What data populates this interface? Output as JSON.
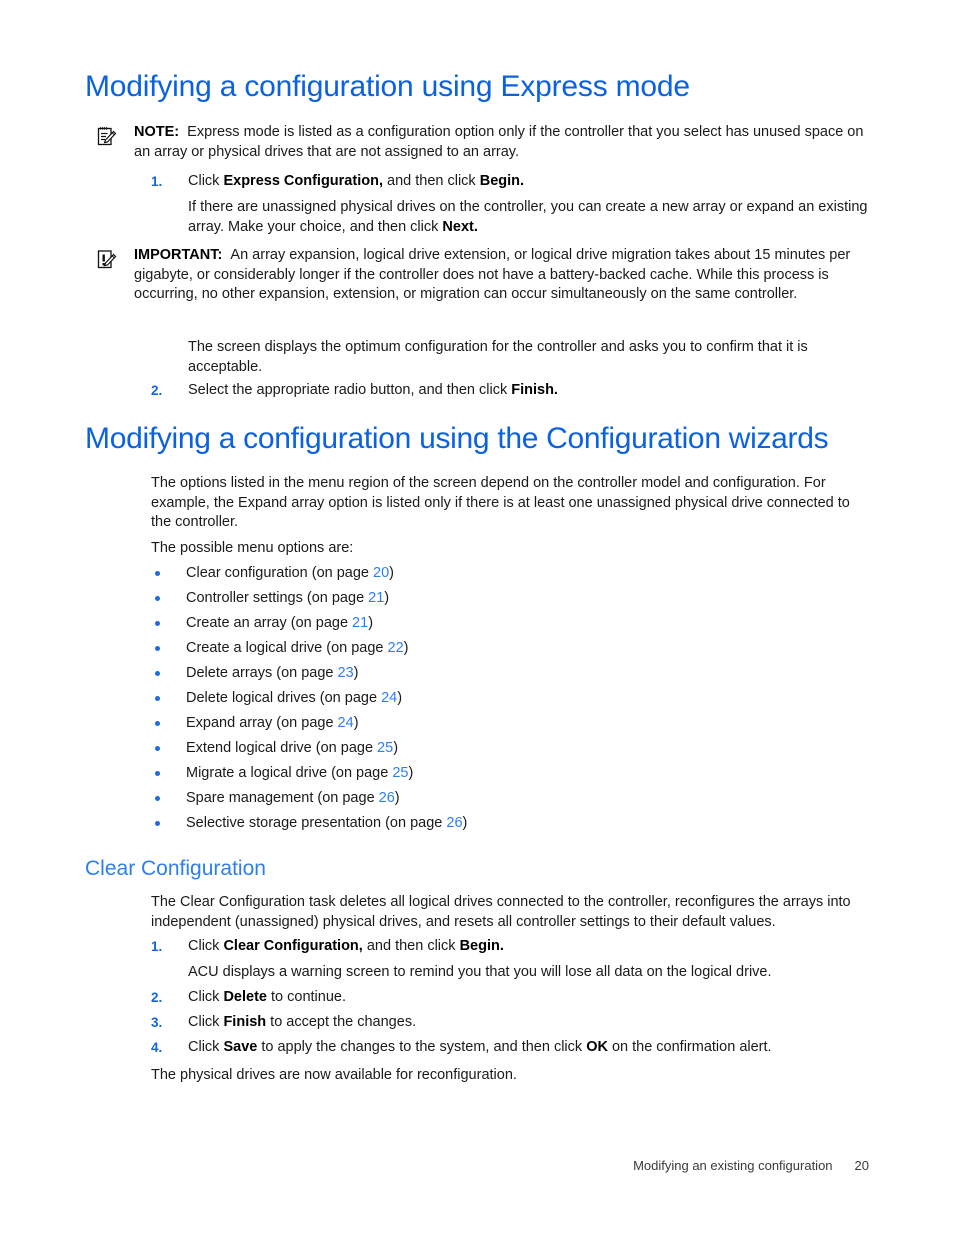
{
  "document": {
    "section1": {
      "heading": "Modifying a configuration using Express mode",
      "note": {
        "icon": "note-pad-pencil-icon",
        "label": "NOTE:",
        "text": "Express mode is listed as a configuration option only if the controller that you select has unused space on an array or physical drives that are not assigned to an array."
      },
      "steps": [
        {
          "num": "1.",
          "parts": [
            {
              "t": "Click ",
              "b": false
            },
            {
              "t": "Express Configuration,",
              "b": true
            },
            {
              "t": " and then click ",
              "b": false
            },
            {
              "t": "Begin.",
              "b": true
            }
          ]
        }
      ],
      "step1_followup": "If there are unassigned physical drives on the controller, you can create a new array or expand an existing array. Make your choice, and then click ",
      "step1_followup_bold": "Next.",
      "important": {
        "icon": "important-pad-pencil-icon",
        "label": "IMPORTANT:",
        "text": "An array expansion, logical drive extension, or logical drive migration takes about 15 minutes per gigabyte, or considerably longer if the controller does not have a battery-backed cache. While this process is occurring, no other expansion, extension, or migration can occur simultaneously on the same controller."
      },
      "screen_para": "The screen displays the optimum configuration for the controller and asks you to confirm that it is acceptable.",
      "step2": {
        "num": "2.",
        "text": "Select the appropriate radio button, and then click ",
        "bold": "Finish."
      }
    },
    "section2": {
      "heading": "Modifying a configuration using the Configuration wizards",
      "intro": "The options listed in the menu region of the screen depend on the controller model and configuration. For example, the Expand array option is listed only if there is at least one unassigned physical drive connected to the controller.",
      "lead_in": "The possible menu options are:",
      "menu_options": [
        {
          "label": "Clear configuration (on page ",
          "page": "20",
          "close": ")"
        },
        {
          "label": "Controller settings (on page ",
          "page": "21",
          "close": ")"
        },
        {
          "label": "Create an array (on page ",
          "page": "21",
          "close": ")"
        },
        {
          "label": "Create a logical drive (on page ",
          "page": "22",
          "close": ")"
        },
        {
          "label": "Delete arrays (on page ",
          "page": "23",
          "close": ")"
        },
        {
          "label": "Delete logical drives (on page ",
          "page": "24",
          "close": ")"
        },
        {
          "label": "Expand array (on page ",
          "page": "24",
          "close": ")"
        },
        {
          "label": "Extend logical drive (on page ",
          "page": "25",
          "close": ")"
        },
        {
          "label": "Migrate a logical drive (on page ",
          "page": "25",
          "close": ")"
        },
        {
          "label": "Spare management (on page ",
          "page": "26",
          "close": ")"
        },
        {
          "label": "Selective storage presentation (on page ",
          "page": "26",
          "close": ")"
        }
      ]
    },
    "section3": {
      "heading": "Clear Configuration",
      "intro": "The Clear Configuration task deletes all logical drives connected to the controller, reconfigures the arrays into independent (unassigned) physical drives, and resets all controller settings to their default values.",
      "step1": {
        "num": "1.",
        "pre": "Click ",
        "bold1": "Clear Configuration,",
        "mid": " and then click ",
        "bold2": "Begin."
      },
      "step1_followup": "ACU displays a warning screen to remind you that you will lose all data on the logical drive.",
      "step2": {
        "num": "2.",
        "pre": "Click ",
        "bold1": "Delete",
        "post": " to continue."
      },
      "step3": {
        "num": "3.",
        "pre": "Click ",
        "bold1": "Finish",
        "post": " to accept the changes."
      },
      "step4": {
        "num": "4.",
        "pre": "Click ",
        "bold1": "Save",
        "mid": " to apply the changes to the system, and then click ",
        "bold2": "OK",
        "post": " on the confirmation alert."
      },
      "closing": "The physical drives are now available for reconfiguration."
    },
    "footer": {
      "title": "Modifying an existing configuration",
      "page_number": "20"
    },
    "colors": {
      "heading_blue": "#0a62e0",
      "subheading_blue": "#2e7ef2",
      "link_blue": "#2e7ef2",
      "list_number_blue": "#1264e0",
      "bullet_blue": "#1c6ae4",
      "body_text": "#1a1a1a",
      "page_background": "#ffffff"
    }
  }
}
